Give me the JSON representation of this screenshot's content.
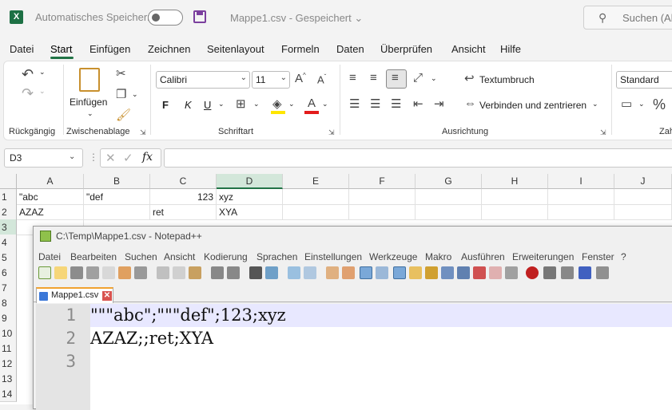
{
  "titlebar": {
    "app_icon": "X",
    "autosave_label": "Automatisches Speichern",
    "doc_title": "Mappe1.csv  -  Gespeichert  ⌄",
    "search_placeholder": "Suchen (Alt"
  },
  "tabs": [
    "Datei",
    "Start",
    "Einfügen",
    "Zeichnen",
    "Seitenlayout",
    "Formeln",
    "Daten",
    "Überprüfen",
    "Ansicht",
    "Hilfe"
  ],
  "ribbon": {
    "groups": {
      "undo": "Rückgängig",
      "clipboard": "Zwischenablage",
      "font": "Schriftart",
      "alignment": "Ausrichtung",
      "number": "Zah"
    },
    "paste_label": "Einfügen",
    "font_name": "Calibri",
    "font_size": "11",
    "wrap_text": "Textumbruch",
    "merge_center": "Verbinden und zentrieren",
    "number_format": "Standard",
    "bold": "F",
    "italic": "K",
    "underline": "U"
  },
  "formula_bar": {
    "name_box": "D3",
    "fx": "fx",
    "value": ""
  },
  "grid": {
    "columns": [
      "A",
      "B",
      "C",
      "D",
      "E",
      "F",
      "G",
      "H",
      "I",
      "J"
    ],
    "rows": [
      "1",
      "2",
      "3",
      "4",
      "5",
      "6",
      "7",
      "8",
      "9",
      "10",
      "11",
      "12",
      "13",
      "14"
    ],
    "cells": {
      "A1": "\"abc",
      "B1": "\"def",
      "C1": "123",
      "D1": "xyz",
      "A2": "AZAZ",
      "C2": "ret",
      "D2": "XYA"
    }
  },
  "notepad": {
    "title": "C:\\Temp\\Mappe1.csv - Notepad++",
    "menu": [
      "Datei",
      "Bearbeiten",
      "Suchen",
      "Ansicht",
      "Kodierung",
      "Sprachen",
      "Einstellungen",
      "Werkzeuge",
      "Makro",
      "Ausführen",
      "Erweiterungen",
      "Fenster",
      "?"
    ],
    "tab_label": "Mappe1.csv",
    "line_numbers": [
      "1",
      "2",
      "3"
    ],
    "lines": [
      "\"\"\"abc\";\"\"\"def\";123;xyz",
      "AZAZ;;ret;XYA",
      ""
    ]
  }
}
